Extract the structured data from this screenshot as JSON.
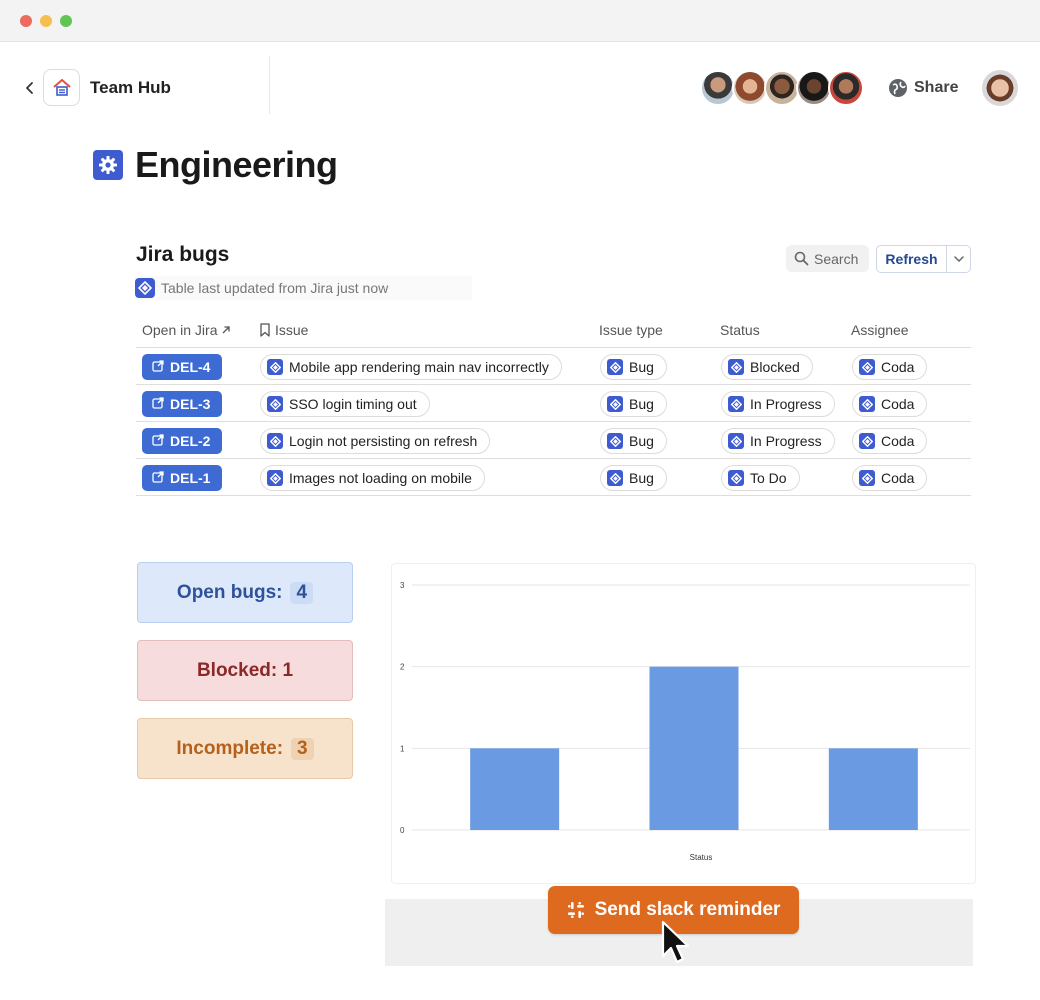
{
  "header": {
    "doc_name": "Team Hub",
    "share_label": "Share"
  },
  "page": {
    "title": "Engineering",
    "icon": "gear-icon"
  },
  "jira": {
    "title": "Jira bugs",
    "sync_note": "Table last updated from Jira just now",
    "search_label": "Search",
    "refresh_label": "Refresh",
    "columns": [
      "Open in Jira",
      "Issue",
      "Issue type",
      "Status",
      "Assignee"
    ],
    "rows": [
      {
        "key": "DEL-4",
        "issue": "Mobile app rendering main nav incorrectly",
        "type": "Bug",
        "status": "Blocked",
        "assignee": "Coda"
      },
      {
        "key": "DEL-3",
        "issue": "SSO login timing out",
        "type": "Bug",
        "status": "In Progress",
        "assignee": "Coda"
      },
      {
        "key": "DEL-2",
        "issue": "Login not persisting on refresh",
        "type": "Bug",
        "status": "In Progress",
        "assignee": "Coda"
      },
      {
        "key": "DEL-1",
        "issue": "Images not loading on mobile",
        "type": "Bug",
        "status": "To Do",
        "assignee": "Coda"
      }
    ]
  },
  "stats": {
    "open_label": "Open bugs:",
    "open_value": "4",
    "blocked_label": "Blocked: 1",
    "incomplete_label": "Incomplete:",
    "incomplete_value": "3"
  },
  "chart_data": {
    "type": "bar",
    "categories": [
      "",
      "",
      ""
    ],
    "values": [
      1,
      2,
      1
    ],
    "xlabel": "Status",
    "ylabel": "",
    "ylim": [
      0,
      3
    ],
    "yticks": [
      0,
      1,
      2,
      3
    ],
    "grid": true,
    "bar_color": "#6a9ae2"
  },
  "action": {
    "slack_label": "Send slack reminder"
  },
  "colors": {
    "brand_blue": "#3e5ccf",
    "key_chip": "#3e6ad4",
    "slack_orange": "#dd6a1f"
  }
}
